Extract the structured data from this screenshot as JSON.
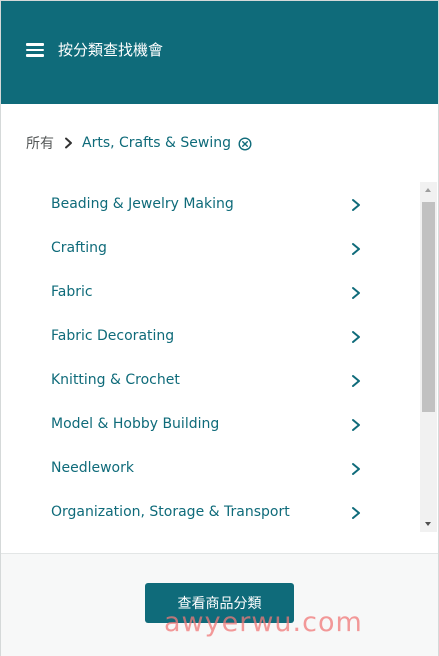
{
  "header": {
    "menu_icon": "hamburger-menu-icon",
    "title": "按分類查找機會"
  },
  "breadcrumb": {
    "root": "所有",
    "separator_icon": "chevron-right-icon",
    "current": "Arts, Crafts & Sewing",
    "clear_icon": "circle-x-icon"
  },
  "categories": [
    {
      "label": "Beading & Jewelry Making"
    },
    {
      "label": "Crafting"
    },
    {
      "label": "Fabric"
    },
    {
      "label": "Fabric Decorating"
    },
    {
      "label": "Knitting & Crochet"
    },
    {
      "label": "Model & Hobby Building"
    },
    {
      "label": "Needlework"
    },
    {
      "label": "Organization, Storage & Transport"
    }
  ],
  "footer": {
    "button_label": "查看商品分類"
  },
  "watermark": "awyerwu.com",
  "colors": {
    "header_bg": "#0f6b7a",
    "accent_text": "#0f6b7a",
    "muted_text": "#565959",
    "footer_bg": "#f7f8f8",
    "scrollbar_track": "#f1f1f1",
    "scrollbar_thumb": "#c1c1c1",
    "watermark": "#f07878"
  }
}
